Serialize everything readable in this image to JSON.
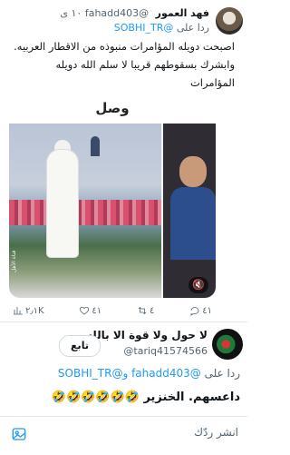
{
  "tweet1": {
    "author_name": "فهد العمور",
    "author_handle": "@fahadd403",
    "time": "١٠ ى",
    "reply_label": "ردا على",
    "reply_mention": "@SOBHI_TR",
    "text": "اصبحت دويله المؤامرات منبوذه من الاقطار العربيه. وابشرك بسقوطهم قريبا لا سلم الله دويله المؤامرات",
    "media": {
      "overlay_text": "وصل",
      "logo_text": "قناة الأهل"
    },
    "stats": {
      "views": "٢٫١K",
      "likes": "٤١",
      "retweets": "٤",
      "replies": "٤١"
    }
  },
  "tweet2": {
    "author_name": "لا حول ولا قوة الا بالله",
    "author_handle": "@tariq41574566",
    "follow_label": "تابع",
    "reply_label": "ردا على",
    "reply_mentions": "@fahadd403 و@SOBHI_TR",
    "text": "داعسهم. الخنزير 🤣🤣🤣🤣🤣🤣"
  },
  "composer": {
    "placeholder": "انشر ردّك"
  },
  "icons": {
    "views": "chart-icon",
    "likes": "heart-icon",
    "retweets": "retweet-icon",
    "replies": "reply-icon",
    "mute": "speaker-muted-icon",
    "photo": "image-icon"
  },
  "colors": {
    "accent": "#1d9bf0",
    "secondary_text": "#536471"
  }
}
